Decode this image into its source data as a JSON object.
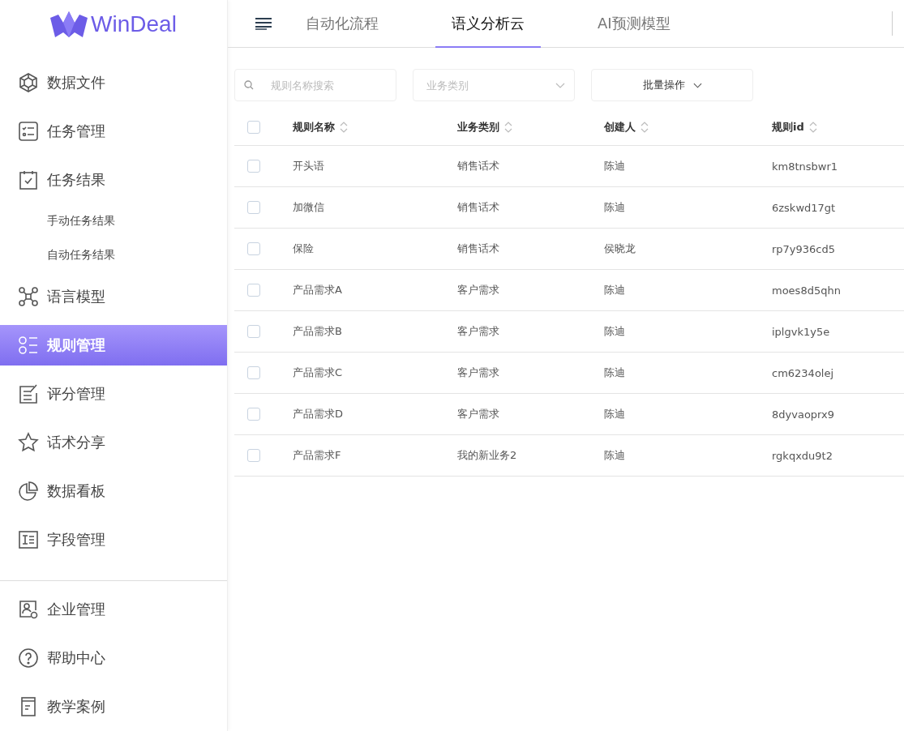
{
  "logo": {
    "text": "WinDeal"
  },
  "sidebar": {
    "items": [
      {
        "label": "数据文件",
        "selected": false
      },
      {
        "label": "任务管理",
        "selected": false
      },
      {
        "label": "任务结果",
        "selected": false,
        "children": [
          {
            "label": "手动任务结果",
            "selected": false
          },
          {
            "label": "自动任务结果",
            "selected": false
          }
        ]
      },
      {
        "label": "语言模型",
        "selected": false
      },
      {
        "label": "规则管理",
        "selected": true
      },
      {
        "label": "评分管理",
        "selected": false
      },
      {
        "label": "话术分享",
        "selected": false
      },
      {
        "label": "数据看板",
        "selected": false
      },
      {
        "label": "字段管理",
        "selected": false
      }
    ],
    "bottom_items": [
      {
        "label": "企业管理",
        "selected": false
      },
      {
        "label": "帮助中心",
        "selected": false
      },
      {
        "label": "教学案例",
        "selected": false
      }
    ]
  },
  "tabs": [
    {
      "label": "自动化流程",
      "selected": false
    },
    {
      "label": "语义分析云",
      "selected": true
    },
    {
      "label": "AI预测模型",
      "selected": false
    }
  ],
  "filters": {
    "search": {
      "placeholder": "规则名称搜索"
    },
    "category": {
      "placeholder": "业务类别"
    },
    "batch": {
      "label": "批量操作"
    }
  },
  "table": {
    "header_checked": false,
    "columns": [
      "规则名称",
      "业务类别",
      "创建人",
      "规则id"
    ],
    "rows": [
      {
        "checked": false,
        "cells": [
          "开头语",
          "销售话术",
          "陈迪",
          "km8tnsbwr1"
        ]
      },
      {
        "checked": false,
        "cells": [
          "加微信",
          "销售话术",
          "陈迪",
          "6zskwd17gt"
        ]
      },
      {
        "checked": false,
        "cells": [
          "保险",
          "销售话术",
          "侯晓龙",
          "rp7y936cd5"
        ]
      },
      {
        "checked": false,
        "cells": [
          "产品需求A",
          "客户需求",
          "陈迪",
          "moes8d5qhn"
        ]
      },
      {
        "checked": false,
        "cells": [
          "产品需求B",
          "客户需求",
          "陈迪",
          "iplgvk1y5e"
        ]
      },
      {
        "checked": false,
        "cells": [
          "产品需求C",
          "客户需求",
          "陈迪",
          "cm6234olej"
        ]
      },
      {
        "checked": false,
        "cells": [
          "产品需求D",
          "客户需求",
          "陈迪",
          "8dyvaoprx9"
        ]
      },
      {
        "checked": false,
        "cells": [
          "产品需求F",
          "我的新业务2",
          "陈迪",
          "rgkqxdu9t2"
        ]
      }
    ]
  }
}
